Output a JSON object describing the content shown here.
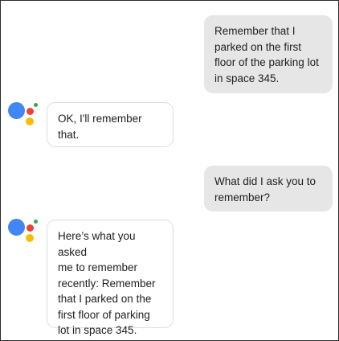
{
  "assistant_name": "Google Assistant",
  "colors": {
    "blue": "#4285f4",
    "red": "#ea4335",
    "yellow": "#fbbc05",
    "green": "#34a853",
    "user_bubble": "#e6e6e6",
    "assistant_border": "#dadce0"
  },
  "messages": [
    {
      "sender": "user",
      "text": "Remember that I\nparked on the first\nfloor of the parking lot\nin space 345."
    },
    {
      "sender": "assistant",
      "icon": "google-assistant-logo-icon",
      "text": "OK, I'll remember\nthat."
    },
    {
      "sender": "user",
      "text": "What did I ask you to\nremember?"
    },
    {
      "sender": "assistant",
      "icon": "google-assistant-logo-icon",
      "text": "Here’s what you asked\nme to remember\nrecently: Remember\nthat I parked on the\nfirst floor of parking\nlot in space 345."
    }
  ]
}
